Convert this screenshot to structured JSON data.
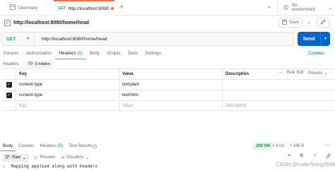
{
  "tabs": {
    "overview": "Overview",
    "active": {
      "method": "GET",
      "url": "http://localhost:8080/h"
    },
    "environment": "No environment"
  },
  "request": {
    "title": "http://localhost:8080/home/head",
    "save_label": "Save",
    "method": "GET",
    "url": "http://localhost:8080/home/head",
    "send_label": "Send"
  },
  "request_tabs": [
    {
      "label": "Params"
    },
    {
      "label": "Authorization"
    },
    {
      "label": "Headers",
      "count": "(8)"
    },
    {
      "label": "Body"
    },
    {
      "label": "Scripts"
    },
    {
      "label": "Tests"
    },
    {
      "label": "Settings"
    }
  ],
  "cookies_label": "Cookies",
  "headers_section": {
    "label": "Headers",
    "hidden_toggle": "6 hidden",
    "columns": {
      "key": "Key",
      "value": "Value",
      "description": "Description"
    },
    "bulk_edit": "Bulk Edit",
    "presets": "Presets",
    "rows": [
      {
        "key": "content-type",
        "value": "text/plain",
        "description": ""
      },
      {
        "key": "content-type",
        "value": "text/html",
        "description": ""
      }
    ],
    "placeholders": {
      "key": "Key",
      "value": "Value",
      "description": "Description"
    }
  },
  "response": {
    "tabs": [
      {
        "label": "Body"
      },
      {
        "label": "Cookies"
      },
      {
        "label": "Headers",
        "count": "(5)"
      },
      {
        "label": "Test Results"
      }
    ],
    "status": "200 OK",
    "time": "4 ms",
    "size": "198 B",
    "format": "Raw",
    "preview": "Preview",
    "visualize": "Visualize",
    "lines": [
      {
        "no": "1",
        "text": "Mapping applied along with headers"
      }
    ]
  },
  "watermark": "CSDN @coderSong2568",
  "colors": {
    "accent": "#ff6c37",
    "get_method": "#0cbb52",
    "send_button": "#0265d2",
    "status_ok": "#0a8a3e"
  }
}
